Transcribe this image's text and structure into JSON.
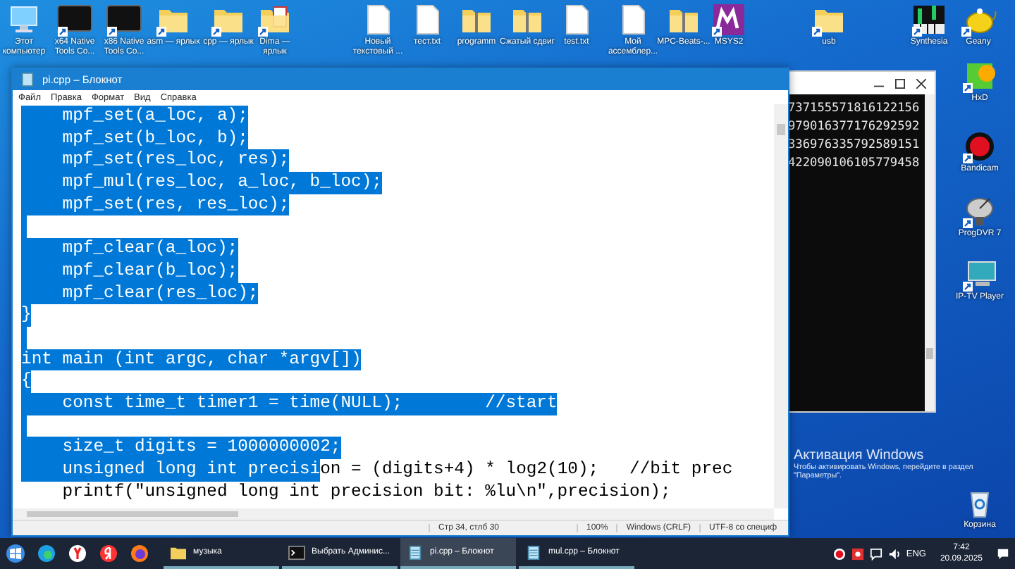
{
  "desktop_icons": [
    {
      "label": "Этот компьютер",
      "kind": "computer"
    },
    {
      "label": "x64 Native Tools Co...",
      "kind": "console"
    },
    {
      "label": "x86 Native Tools Co...",
      "kind": "console"
    },
    {
      "label": "asm — ярлык",
      "kind": "folder"
    },
    {
      "label": "cpp — ярлык",
      "kind": "folder"
    },
    {
      "label": "Dima — ярлык",
      "kind": "folder-file"
    },
    {
      "label": "Новый текстовый ...",
      "kind": "file"
    },
    {
      "label": "тест.txt",
      "kind": "file"
    },
    {
      "label": "programm",
      "kind": "zip"
    },
    {
      "label": "Сжатый сдвиг",
      "kind": "zip"
    },
    {
      "label": "test.txt",
      "kind": "file"
    },
    {
      "label": "Мой ассемблер...",
      "kind": "file"
    },
    {
      "label": "MPC-Beats-...",
      "kind": "zip"
    },
    {
      "label": "MSYS2",
      "kind": "msys"
    },
    {
      "label": "usb",
      "kind": "folder"
    },
    {
      "label": "Synthesia",
      "kind": "keys"
    },
    {
      "label": "Geany",
      "kind": "teapot"
    },
    {
      "label": "HxD",
      "kind": "hex"
    },
    {
      "label": "Bandicam",
      "kind": "record"
    },
    {
      "label": "ProgDVR 7",
      "kind": "dish"
    },
    {
      "label": "IP-TV Player",
      "kind": "tv"
    },
    {
      "label": "Корзина",
      "kind": "bin"
    }
  ],
  "console_window": {
    "lines": [
      "737155571816122156",
      "979016377176292592",
      "336976335792589151",
      "422090106105779458"
    ]
  },
  "notepad": {
    "title": "pi.cpp – Блокнот",
    "menu": [
      "Файл",
      "Правка",
      "Формат",
      "Вид",
      "Справка"
    ],
    "lines": [
      {
        "text": "    mpf_set(a_loc, a);",
        "selected": true
      },
      {
        "text": "    mpf_set(b_loc, b);",
        "selected": true
      },
      {
        "text": "    mpf_set(res_loc, res);",
        "selected": true
      },
      {
        "text": "    mpf_mul(res_loc, a_loc, b_loc);",
        "selected": true
      },
      {
        "text": "    mpf_set(res, res_loc);",
        "selected": true
      },
      {
        "selected": true
      },
      {
        "text": "    mpf_clear(a_loc);",
        "selected": true
      },
      {
        "text": "    mpf_clear(b_loc);",
        "selected": true
      },
      {
        "text": "    mpf_clear(res_loc);",
        "selected": true
      },
      {
        "text": "}",
        "selected": true
      },
      {
        "selected": true
      },
      {
        "text": "int main (int argc, char *argv[])",
        "selected": true
      },
      {
        "text": "{",
        "selected": true
      },
      {
        "text": "    const time_t timer1 = time(NULL);        //start",
        "selected": true
      },
      {
        "selected": true
      },
      {
        "text": "    size_t digits = 1000000002;",
        "selected": true
      },
      {
        "text": "    unsigned long int precisi",
        "selected": true,
        "rest": "on = (digits+4) * log2(10);   //bit prec"
      },
      {
        "text": "    printf(\"unsigned long int precision bit: %lu\\n\",precision);",
        "selected": false
      }
    ],
    "status_bar": [
      "Стр 34, стлб 30",
      "100%",
      "Windows (CRLF)",
      "UTF-8 со специф"
    ]
  },
  "activation": {
    "title": "Активация Windows",
    "line_1": "Чтобы активировать Windows, перейдите в раздел",
    "line_2": "\"Параметры\"."
  },
  "taskbar": {
    "buttons": [
      {
        "label": "музыка",
        "kind": "folder",
        "selected": false
      },
      {
        "label": "Выбрать Админис...",
        "kind": "console",
        "selected": false
      },
      {
        "label": "pi.cpp – Блокнот",
        "kind": "notepad",
        "selected": true
      },
      {
        "label": "mul.cpp – Блокнот",
        "kind": "notepad",
        "selected": false
      }
    ],
    "language": "ENG",
    "time": "7:42",
    "date": "20.09.2025"
  }
}
